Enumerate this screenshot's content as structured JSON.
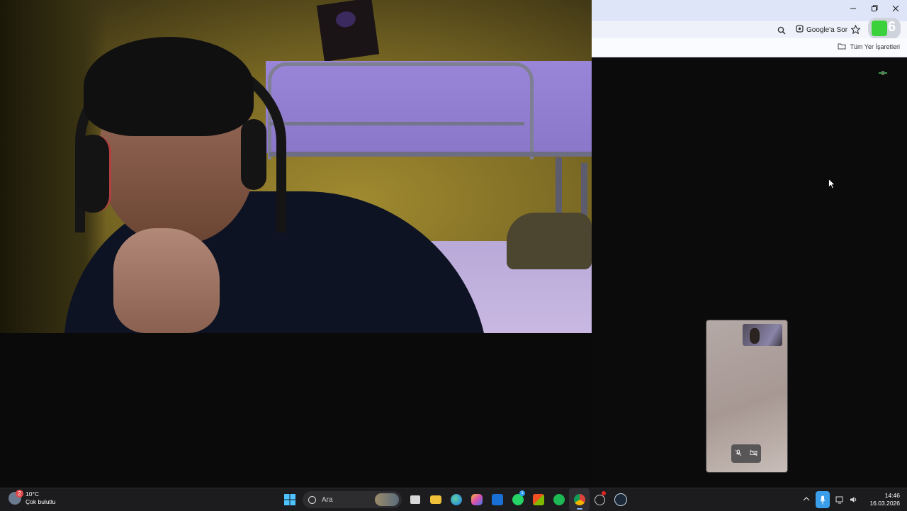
{
  "browser": {
    "ask_google": "Google'a Sor",
    "profile_number": "6",
    "bookmarks_all": "Tüm Yer İşaretleri",
    "icons": [
      "minimize-icon",
      "restore-icon",
      "close-icon",
      "search-icon",
      "google-lens-icon",
      "star-icon",
      "folder-icon"
    ]
  },
  "taskbar": {
    "weather_temp": "10°C",
    "weather_desc": "Çok bulutlu",
    "weather_badge": "2",
    "search_placeholder": "Ara",
    "whatsapp_badge": "1",
    "time": "14:46",
    "date": "16.03.2026"
  },
  "colors": {
    "chrome_titlebar": "#dee5f8",
    "page_bg": "#0b0b0c",
    "taskbar_bg": "#1c1c1e",
    "mic_accent": "#3b9eea"
  }
}
